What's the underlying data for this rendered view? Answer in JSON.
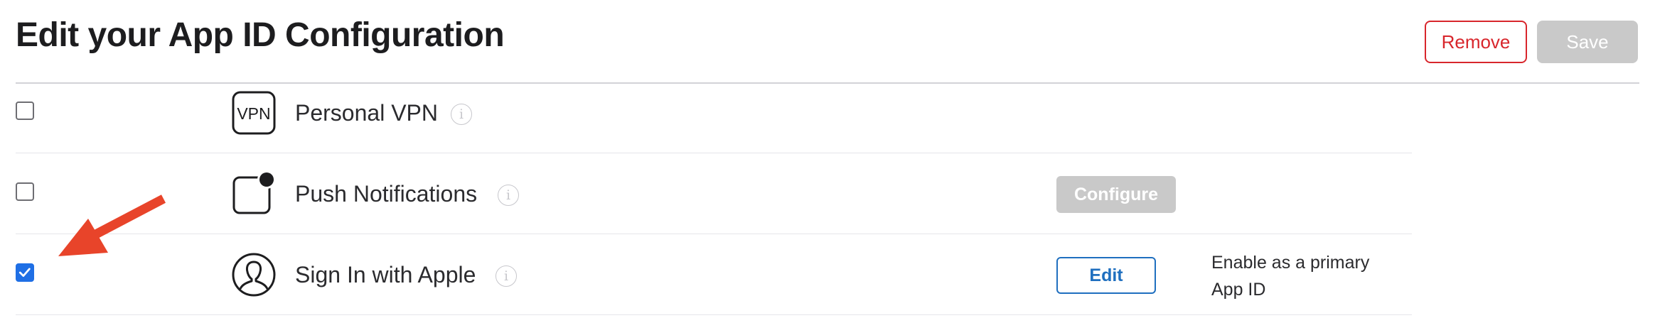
{
  "header": {
    "title": "Edit your App ID Configuration",
    "remove_label": "Remove",
    "save_label": "Save"
  },
  "capabilities": [
    {
      "name": "Personal VPN",
      "icon": "vpn-icon",
      "icon_text": "VPN",
      "checked": false
    },
    {
      "name": "Push Notifications",
      "icon": "push-notifications-icon",
      "checked": false,
      "action_label": "Configure",
      "action_enabled": false
    },
    {
      "name": "Sign In with Apple",
      "icon": "sign-in-with-apple-icon",
      "checked": true,
      "action_label": "Edit",
      "action_enabled": true,
      "note": "Enable as a primary App ID"
    }
  ],
  "annotation": {
    "type": "arrow",
    "color": "#e8442a",
    "points_to": "sign-in-with-apple-checkbox"
  },
  "colors": {
    "accent": "#1f6fe5",
    "destructive": "#d8262c",
    "disabled": "#c9c9c9",
    "link": "#1f6fbf"
  }
}
